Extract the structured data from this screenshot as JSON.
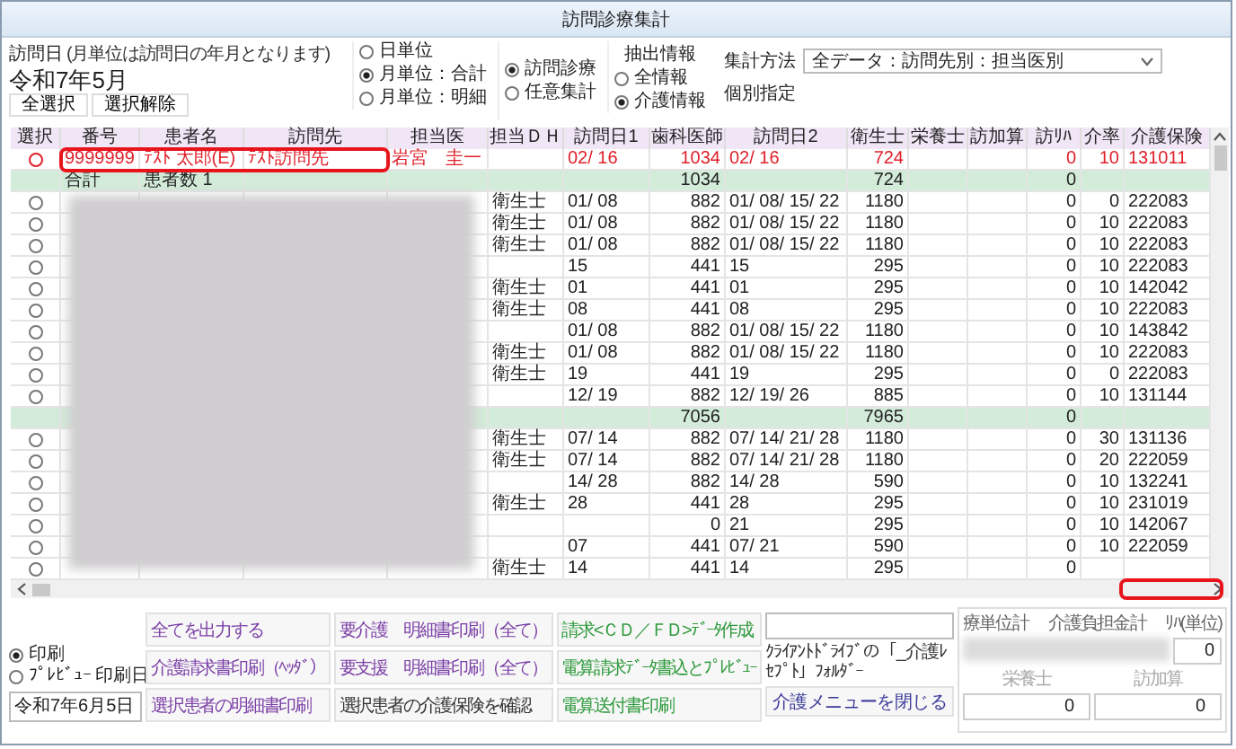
{
  "window": {
    "title": "訪問診療集計"
  },
  "visit_date": {
    "label": "訪問日",
    "note": "(月単位は訪問日の年月となります)",
    "value": "令和7年5月"
  },
  "selection_buttons": [
    "全選択",
    "選択解除"
  ],
  "unit_options": [
    {
      "label": "日単位",
      "selected": false
    },
    {
      "label": "月単位：合計",
      "selected": true
    },
    {
      "label": "月単位：明細",
      "selected": false
    }
  ],
  "mode_options": [
    {
      "label": "訪問診療",
      "selected": true
    },
    {
      "label": "任意集計",
      "selected": false
    }
  ],
  "extract": {
    "title": "抽出情報",
    "options": [
      {
        "label": "全情報",
        "selected": false
      },
      {
        "label": "介護情報",
        "selected": true
      }
    ]
  },
  "method": {
    "label": "集計方法",
    "value": "全データ：訪問先別：担当医別",
    "individual": "個別指定"
  },
  "table": {
    "columns": [
      "選択",
      "番号",
      "患者名",
      "訪問先",
      "担当医",
      "担当ＤＨ",
      "訪問日1",
      "歯科医師",
      "訪問日2",
      "衛生士",
      "栄養士",
      "訪加算",
      "訪ﾘﾊ",
      "介率",
      "介護保険"
    ],
    "rows": [
      {
        "kind": "patient",
        "selected": false,
        "flagged": true,
        "cells": [
          null,
          "9999999",
          "ﾃｽﾄ 太郎(E)",
          "ﾃｽﾄ訪問先",
          "岩宮　圭一",
          null,
          "02/ 16",
          "1034",
          "02/ 16",
          "724",
          null,
          null,
          "0",
          "10",
          "131011"
        ]
      },
      {
        "kind": "total",
        "cells": [
          null,
          "合計",
          "患者数 1",
          null,
          null,
          null,
          null,
          "1034",
          null,
          "724",
          null,
          null,
          "0",
          null,
          null
        ]
      },
      {
        "kind": "patient",
        "selected": false,
        "flagged": false,
        "cells": [
          null,
          null,
          null,
          null,
          null,
          "衛生士",
          "01/ 08",
          "882",
          "01/ 08/ 15/ 22",
          "1180",
          null,
          null,
          "0",
          "0",
          "222083"
        ]
      },
      {
        "kind": "patient",
        "selected": false,
        "flagged": false,
        "cells": [
          null,
          null,
          null,
          null,
          null,
          "衛生士",
          "01/ 08",
          "882",
          "01/ 08/ 15/ 22",
          "1180",
          null,
          null,
          "0",
          "10",
          "222083"
        ]
      },
      {
        "kind": "patient",
        "selected": false,
        "flagged": false,
        "cells": [
          null,
          null,
          null,
          null,
          null,
          "衛生士",
          "01/ 08",
          "882",
          "01/ 08/ 15/ 22",
          "1180",
          null,
          null,
          "0",
          "10",
          "222083"
        ]
      },
      {
        "kind": "patient",
        "selected": false,
        "flagged": false,
        "cells": [
          null,
          null,
          null,
          null,
          null,
          null,
          "15",
          "441",
          "15",
          "295",
          null,
          null,
          "0",
          "10",
          "222083"
        ]
      },
      {
        "kind": "patient",
        "selected": false,
        "flagged": false,
        "cells": [
          null,
          null,
          null,
          null,
          null,
          "衛生士",
          "01",
          "441",
          "01",
          "295",
          null,
          null,
          "0",
          "10",
          "142042"
        ]
      },
      {
        "kind": "patient",
        "selected": false,
        "flagged": false,
        "cells": [
          null,
          null,
          null,
          null,
          null,
          "衛生士",
          "08",
          "441",
          "08",
          "295",
          null,
          null,
          "0",
          "10",
          "222083"
        ]
      },
      {
        "kind": "patient",
        "selected": false,
        "flagged": false,
        "cells": [
          null,
          null,
          null,
          null,
          null,
          null,
          "01/ 08",
          "882",
          "01/ 08/ 15/ 22",
          "1180",
          null,
          null,
          "0",
          "10",
          "143842"
        ]
      },
      {
        "kind": "patient",
        "selected": false,
        "flagged": false,
        "cells": [
          null,
          null,
          null,
          null,
          null,
          "衛生士",
          "01/ 08",
          "882",
          "01/ 08/ 15/ 22",
          "1180",
          null,
          null,
          "0",
          "10",
          "222083"
        ]
      },
      {
        "kind": "patient",
        "selected": false,
        "flagged": false,
        "cells": [
          null,
          null,
          null,
          null,
          null,
          "衛生士",
          "19",
          "441",
          "19",
          "295",
          null,
          null,
          "0",
          "0",
          "222083"
        ]
      },
      {
        "kind": "patient",
        "selected": false,
        "flagged": false,
        "cells": [
          null,
          null,
          null,
          null,
          null,
          null,
          "12/ 19",
          "882",
          "12/ 19/ 26",
          "885",
          null,
          null,
          "0",
          "10",
          "131144"
        ]
      },
      {
        "kind": "total",
        "cells": [
          null,
          null,
          null,
          null,
          null,
          null,
          null,
          "7056",
          null,
          "7965",
          null,
          null,
          "0",
          null,
          null
        ]
      },
      {
        "kind": "patient",
        "selected": false,
        "flagged": false,
        "cells": [
          null,
          null,
          null,
          null,
          null,
          "衛生士",
          "07/ 14",
          "882",
          "07/ 14/ 21/ 28",
          "1180",
          null,
          null,
          "0",
          "30",
          "131136"
        ]
      },
      {
        "kind": "patient",
        "selected": false,
        "flagged": false,
        "cells": [
          null,
          null,
          null,
          null,
          null,
          "衛生士",
          "07/ 14",
          "882",
          "07/ 14/ 21/ 28",
          "1180",
          null,
          null,
          "0",
          "20",
          "222059"
        ]
      },
      {
        "kind": "patient",
        "selected": false,
        "flagged": false,
        "cells": [
          null,
          null,
          null,
          null,
          null,
          null,
          "14/ 28",
          "882",
          "14/ 28",
          "590",
          null,
          null,
          "0",
          "10",
          "132241"
        ]
      },
      {
        "kind": "patient",
        "selected": false,
        "flagged": false,
        "cells": [
          null,
          null,
          null,
          null,
          null,
          "衛生士",
          "28",
          "441",
          "28",
          "295",
          null,
          null,
          "0",
          "10",
          "231019"
        ]
      },
      {
        "kind": "patient",
        "selected": false,
        "flagged": false,
        "cells": [
          null,
          null,
          null,
          null,
          null,
          null,
          null,
          "0",
          "21",
          "295",
          null,
          null,
          "0",
          "10",
          "142067"
        ]
      },
      {
        "kind": "patient",
        "selected": false,
        "flagged": false,
        "cells": [
          null,
          null,
          null,
          null,
          null,
          null,
          "07",
          "441",
          "07/ 21",
          "590",
          null,
          null,
          "0",
          "10",
          "222059"
        ]
      },
      {
        "kind": "patient",
        "selected": false,
        "flagged": false,
        "cells": [
          null,
          null,
          null,
          null,
          null,
          "衛生士",
          "14",
          "441",
          "14",
          "295",
          null,
          null,
          "0",
          null,
          null
        ]
      }
    ]
  },
  "print_options": [
    {
      "label": "印刷",
      "selected": true
    },
    {
      "label": "ﾌﾟﾚﾋﾞｭｰ",
      "selected": false
    }
  ],
  "print_date": {
    "label": "印刷日",
    "value": "令和7年6月5日"
  },
  "actions": [
    {
      "label": "全てを出力する",
      "color": "#7b3fa6"
    },
    {
      "label": "介護請求書印刷（ﾍｯﾀﾞ）",
      "color": "#7b3fa6"
    },
    {
      "label": "選択患者の明細書印刷",
      "color": "#7b3fa6"
    },
    {
      "label": "要介護　明細書印刷（全て）",
      "color": "#7b3fa6"
    },
    {
      "label": "要支援　明細書印刷（全て）",
      "color": "#7b3fa6"
    },
    {
      "label": "選択患者の介護保険を確認",
      "color": "#333333"
    },
    {
      "label": "請求<ＣＤ／ＦＤ>ﾃﾞｰﾀ作成",
      "color": "#2e9a3c"
    },
    {
      "label": "電算請求ﾃﾞｰﾀ書込とﾌﾟﾚﾋﾞｭｰ",
      "color": "#2e9a3c"
    },
    {
      "label": "電算送付書印刷",
      "color": "#2e9a3c"
    }
  ],
  "folder": {
    "note": "ｸﾗｲｱﾝﾄﾄﾞﾗｲﾌﾞの「_介護ﾚｾﾌﾟﾄ」ﾌｫﾙﾀﾞｰ"
  },
  "close_button": "介護メニューを閉じる",
  "totals": {
    "labels": [
      "療単位計",
      "介護負担金計",
      "ﾘﾊ(単位)"
    ],
    "value": "0",
    "sub_labels": [
      "栄養士",
      "訪加算"
    ],
    "sub_values": [
      "0",
      "0"
    ]
  }
}
